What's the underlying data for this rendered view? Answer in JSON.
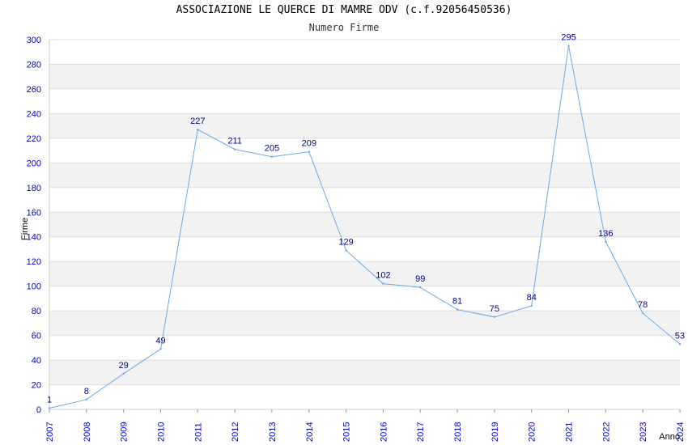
{
  "chart_data": {
    "type": "line",
    "title": "ASSOCIAZIONE LE QUERCE DI MAMRE ODV (c.f.92056450536)",
    "subtitle": "Numero Firme",
    "xlabel": "Anno",
    "ylabel": "Firme",
    "x": [
      "2007",
      "2008",
      "2009",
      "2010",
      "2011",
      "2012",
      "2013",
      "2014",
      "2015",
      "2016",
      "2017",
      "2018",
      "2019",
      "2020",
      "2021",
      "2022",
      "2023",
      "2024"
    ],
    "series": [
      {
        "values": [
          1,
          8,
          29,
          49,
          227,
          211,
          205,
          209,
          129,
          102,
          99,
          81,
          75,
          84,
          295,
          136,
          78,
          53
        ]
      }
    ],
    "ylim": [
      0,
      300
    ],
    "yticks": [
      0,
      20,
      40,
      60,
      80,
      100,
      120,
      140,
      160,
      180,
      200,
      220,
      240,
      260,
      280,
      300
    ],
    "grid": true,
    "colors": {
      "line": "#6aa9e8",
      "band": "#f2f2f2",
      "tick": "#0000cc",
      "label": "#000080",
      "gridline": "#dddddd"
    }
  }
}
